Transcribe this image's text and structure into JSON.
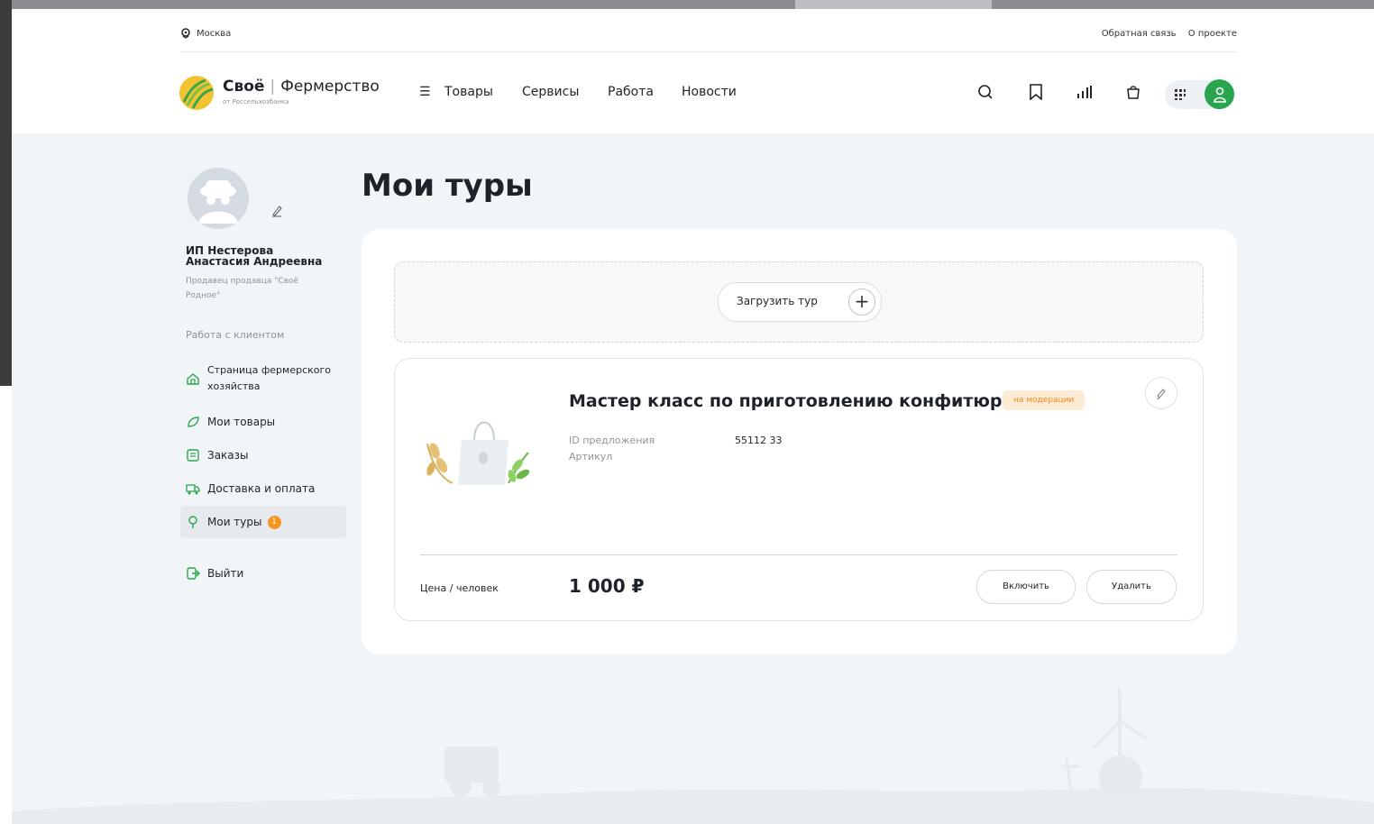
{
  "topbar": {
    "location": "Москва",
    "links": [
      "Обратная связь",
      "О проекте"
    ]
  },
  "brand": {
    "name": "Своё",
    "product": "Фермерство",
    "subtitle": "от Россельхозбанка"
  },
  "nav": {
    "menu_label": "Товары",
    "items": [
      "Сервисы",
      "Работа",
      "Новости"
    ]
  },
  "sidebar": {
    "user_name": "ИП Нестерова Анастасия Андреевна",
    "user_role": "Продавец продавца \"Своё Родное\"",
    "section_title": "Работа с клиентом",
    "items": [
      {
        "label": "Страница фермерского хозяйства"
      },
      {
        "label": "Мои товары"
      },
      {
        "label": "Заказы"
      },
      {
        "label": "Доставка и оплата"
      },
      {
        "label": "Мои туры",
        "badge": "1"
      }
    ],
    "logout_label": "Выйти"
  },
  "main": {
    "title": "Мои туры",
    "upload_label": "Загрузить тур",
    "tour": {
      "title": "Мастер класс по приготовлению конфитюра",
      "status": "на модерации",
      "id_label": "ID предложения",
      "id_value": "55112 33",
      "article_label": "Артикул",
      "price_label": "Цена / человек",
      "price_value": "1 000 ₽",
      "enable_label": "Включить",
      "delete_label": "Удалить"
    }
  },
  "colors": {
    "accent_green": "#2aa54f",
    "badge_orange": "#f7961e",
    "status_bg": "#fdebd6",
    "page_bg": "#f2f5f7"
  }
}
